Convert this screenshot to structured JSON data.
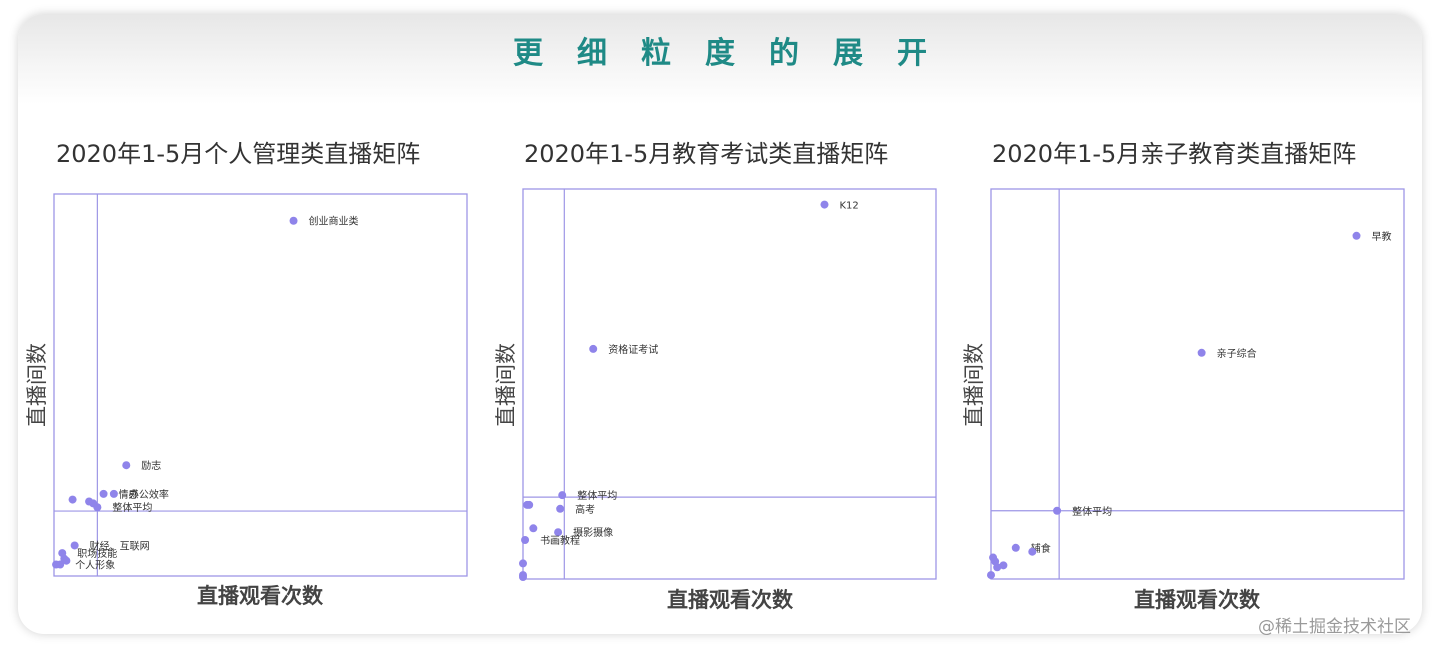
{
  "slide": {
    "title": "更细粒度的展开",
    "watermark": "@稀土掘金技术社区"
  },
  "colors": {
    "title": "#1f8a86",
    "frame": "#9d96e6",
    "point": "#8f84ea",
    "text": "#333333"
  },
  "chart_data": [
    {
      "type": "scatter",
      "title": "2020年1-5月个人管理类直播矩阵",
      "xlabel": "直播观看次数",
      "ylabel": "直播间数",
      "xlim": [
        0,
        100
      ],
      "ylim": [
        0,
        100
      ],
      "reference_lines": {
        "x": 10.5,
        "y": 17
      },
      "points": [
        {
          "label": "创业商业类",
          "x": 58,
          "y": 93
        },
        {
          "label": "励志",
          "x": 17.5,
          "y": 29
        },
        {
          "label": "情感",
          "x": 12,
          "y": 21.5
        },
        {
          "label": "办公效率",
          "x": 14.5,
          "y": 21.5
        },
        {
          "label": "",
          "x": 4.5,
          "y": 20
        },
        {
          "label": "",
          "x": 8.5,
          "y": 19.5
        },
        {
          "label": "",
          "x": 9.5,
          "y": 19
        },
        {
          "label": "整体平均",
          "x": 10.5,
          "y": 18
        },
        {
          "label": "财经、互联网",
          "x": 5,
          "y": 8
        },
        {
          "label": "职场技能",
          "x": 2,
          "y": 6
        },
        {
          "label": "",
          "x": 2.5,
          "y": 4.5
        },
        {
          "label": "",
          "x": 0.5,
          "y": 3
        },
        {
          "label": "个人形象",
          "x": 1.5,
          "y": 3
        },
        {
          "label": "",
          "x": 3,
          "y": 4
        }
      ]
    },
    {
      "type": "scatter",
      "title": "2020年1-5月教育考试类直播矩阵",
      "xlabel": "直播观看次数",
      "ylabel": "直播间数",
      "xlim": [
        0,
        100
      ],
      "ylim": [
        0,
        100
      ],
      "reference_lines": {
        "x": 10,
        "y": 21
      },
      "points": [
        {
          "label": "K12",
          "x": 73,
          "y": 96
        },
        {
          "label": "资格证考试",
          "x": 17,
          "y": 59
        },
        {
          "label": "整体平均",
          "x": 9.5,
          "y": 21.5
        },
        {
          "label": "高考",
          "x": 9,
          "y": 18
        },
        {
          "label": "",
          "x": 1,
          "y": 19
        },
        {
          "label": "",
          "x": 1.5,
          "y": 19
        },
        {
          "label": "",
          "x": 2.5,
          "y": 13
        },
        {
          "label": "摄影摄像",
          "x": 8.5,
          "y": 12
        },
        {
          "label": "书画教程",
          "x": 0.5,
          "y": 10
        },
        {
          "label": "",
          "x": 0,
          "y": 4
        },
        {
          "label": "",
          "x": 0,
          "y": 1
        },
        {
          "label": "",
          "x": 0,
          "y": 0.5
        }
      ]
    },
    {
      "type": "scatter",
      "title": "2020年1-5月亲子教育类直播矩阵",
      "xlabel": "直播观看次数",
      "ylabel": "直播间数",
      "xlim": [
        0,
        100
      ],
      "ylim": [
        0,
        100
      ],
      "reference_lines": {
        "x": 16.5,
        "y": 17.5
      },
      "points": [
        {
          "label": "早教",
          "x": 88.5,
          "y": 88
        },
        {
          "label": "亲子综合",
          "x": 51,
          "y": 58
        },
        {
          "label": "整体平均",
          "x": 16,
          "y": 17.5
        },
        {
          "label": "辅食",
          "x": 6,
          "y": 8
        },
        {
          "label": "",
          "x": 10,
          "y": 7
        },
        {
          "label": "",
          "x": 0.5,
          "y": 5.5
        },
        {
          "label": "",
          "x": 1,
          "y": 4.5
        },
        {
          "label": "",
          "x": 1.5,
          "y": 3
        },
        {
          "label": "",
          "x": 3,
          "y": 3.5
        },
        {
          "label": "",
          "x": 0,
          "y": 1
        }
      ]
    }
  ]
}
